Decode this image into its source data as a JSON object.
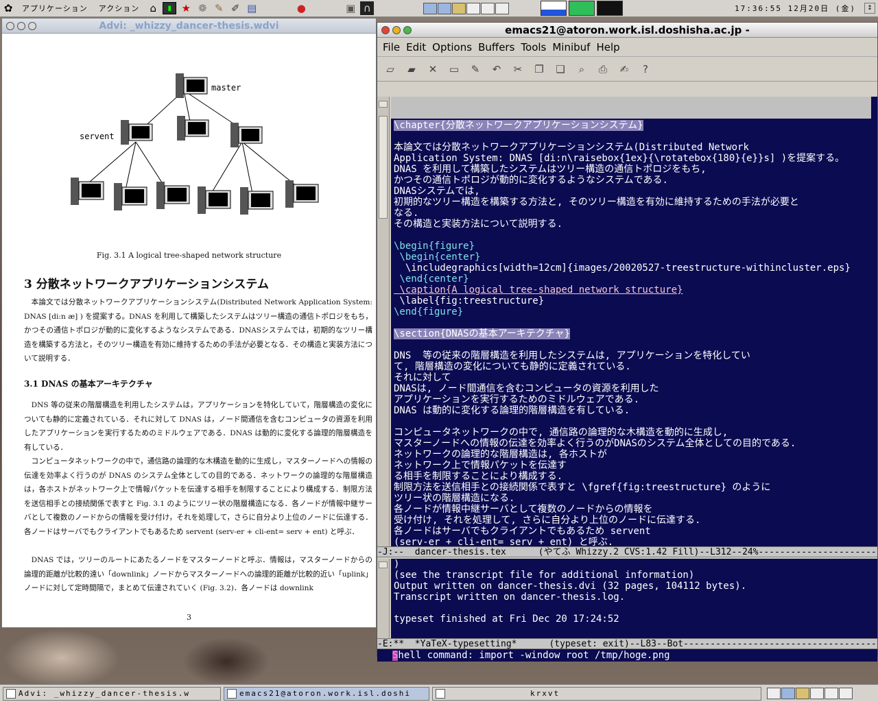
{
  "top_panel": {
    "menus": [
      "アプリケーション",
      "アクション"
    ],
    "launchers": [
      "home-icon",
      "terminal-icon",
      "star-icon",
      "gnome-icon",
      "gimp-icon",
      "editor-icon",
      "apple-icon",
      "folder-icon",
      "exit-icon"
    ],
    "clock": "17:36:55 12月20日 (金)"
  },
  "advi": {
    "title": "Advi: _whizzy_dancer-thesis.wdvi",
    "figure_labels": {
      "master": "master",
      "servent": "servent"
    },
    "figure_caption": "Fig. 3.1   A logical tree-shaped network structure",
    "section_title": "3   分散ネットワークアプリケーションシステム",
    "para1": "本論文では分散ネットワークアプリケーションシステム(Distributed Network Application System: DNAS [di:n ӕ] ) を提案する。DNAS を利用して構築したシステムはツリー構造の通信トポロジをもち，かつその通信トポロジが動的に変化するようなシステムである．DNASシステムでは，初期的なツリー構造を構築する方法と，そのツリー構造を有効に維持するための手法が必要となる．その構造と実装方法について説明する．",
    "subsection_title": "3.1   DNAS の基本アーキテクチャ",
    "para2": "DNS 等の従来の階層構造を利用したシステムは，アプリケーションを特化していて，階層構造の変化についても静的に定義されている．それに対して DNAS は，ノード間通信を含むコンピュータの資源を利用したアプリケーションを実行するためのミドルウェアである．DNAS は動的に変化する論理的階層構造を有している．",
    "para3": "コンピュータネットワークの中で，通信路の論理的な木構造を動的に生成し，マスターノードへの情報の伝達を効率よく行うのが DNAS のシステム全体としての目的である．ネットワークの論理的な階層構造は，各ホストがネットワーク上で情報パケットを伝達する相手を制限することにより構成する．制限方法を送信相手との接続関係で表すと Fig. 3.1 のようにツリー状の階層構造になる．各ノードが情報中継サーバとして複数のノードからの情報を受け付け，それを処理して，さらに自分より上位のノードに伝達する．各ノードはサーバでもクライアントでもあるため servent (serv-er + cli-ent= serv + ent) と呼ぶ．",
    "para4": "DNAS では，ツリーのルートにあたるノードをマスターノードと呼ぶ．情報は，マスターノードからの論理的距離が比較的遠い「downlink」ノードからマスターノードへの論理的距離が比較的近い「uplink」ノードに対して定時間隔で，まとめて伝達されていく (Fig. 3.2)．各ノードは downlink",
    "page_number": "3"
  },
  "emacs": {
    "title": "emacs21@atoron.work.isl.doshisha.ac.jp -",
    "menus": [
      "File",
      "Edit",
      "Options",
      "Buffers",
      "Tools",
      "Minibuf",
      "Help"
    ],
    "toolbar": [
      "new-file-icon",
      "open-folder-icon",
      "close-icon",
      "save-icon",
      "save-as-icon",
      "undo-icon",
      "cut-icon",
      "copy-icon",
      "paste-icon",
      "search-icon",
      "print-icon",
      "preferences-icon",
      "help-icon"
    ],
    "lines": [
      "\\chapter{分散ネットワークアプリケーションシステム}",
      "",
      "本論文では分散ネットワークアプリケーションシステム(Distributed Network",
      "Application System: DNAS [di:n\\raisebox{1ex}{\\rotatebox{180}{e}}s] )を提案する。",
      "DNAS を利用して構築したシステムはツリー構造の通信トポロジをもち,",
      "かつその通信トポロジが動的に変化するようなシステムである.",
      "DNASシステムでは,",
      "初期的なツリー構造を構築する方法と, そのツリー構造を有効に維持するための手法が必要と",
      "なる.",
      "その構造と実装方法について説明する.",
      "",
      "\\begin{figure}",
      " \\begin{center}",
      "  \\includegraphics[width=12cm]{images/20020527-treestructure-withincluster.eps}",
      " \\end{center}",
      " \\caption{A logical tree-shaped network structure}",
      " \\label{fig:treestructure}",
      "\\end{figure}",
      "",
      "\\section{DNASの基本アーキテクチャ}",
      "",
      "DNS  等の従来の階層構造を利用したシステムは, アプリケーションを特化してい",
      "て, 階層構造の変化についても静的に定義されている.",
      "それに対して",
      "DNASは, ノード間通信を含むコンピュータの資源を利用した",
      "アプリケーションを実行するためのミドルウェアである.",
      "DNAS は動的に変化する論理的階層構造を有している.",
      "",
      "コンピュータネットワークの中で, 通信路の論理的な木構造を動的に生成し,",
      "マスターノードへの情報の伝達を効率よく行うのがDNASのシステム全体としての目的である.",
      "ネットワークの論理的な階層構造は, 各ホストが",
      "ネットワーク上で情報パケットを伝達す",
      "る相手を制限することにより構成する.",
      "制限方法を送信相手との接続関係で表すと \\fgref{fig:treestructure} のように",
      "ツリー状の階層構造になる.",
      "各ノードが情報中継サーバとして複数のノードからの情報を",
      "受け付け, それを処理して, さらに自分より上位のノードに伝達する.",
      "各ノードはサーバでもクライアントでもあるため servent",
      "(serv-er + cli-ent= serv + ent) と呼ぶ."
    ],
    "modeline1": "-J:--  dancer-thesis.tex      (やてふ Whizzy.2 CVS:1.42 Fill)--L312--24%-----------------------",
    "transcript": [
      ")",
      "(see the transcript file for additional information)",
      "Output written on dancer-thesis.dvi (32 pages, 104112 bytes).",
      "Transcript written on dancer-thesis.log.",
      "",
      "typeset finished at Fri Dec 20 17:24:52"
    ],
    "modeline2": "-E:**  *YaTeX-typesetting*      (typeset: exit)--L83--Bot------------------------------------",
    "minibuffer": "Shell command: import -window root /tmp/hoge.png"
  },
  "taskbar": {
    "tasks": [
      "Advi: _whizzy_dancer-thesis.w",
      "emacs21@atoron.work.isl.doshi",
      "krxvt"
    ]
  }
}
